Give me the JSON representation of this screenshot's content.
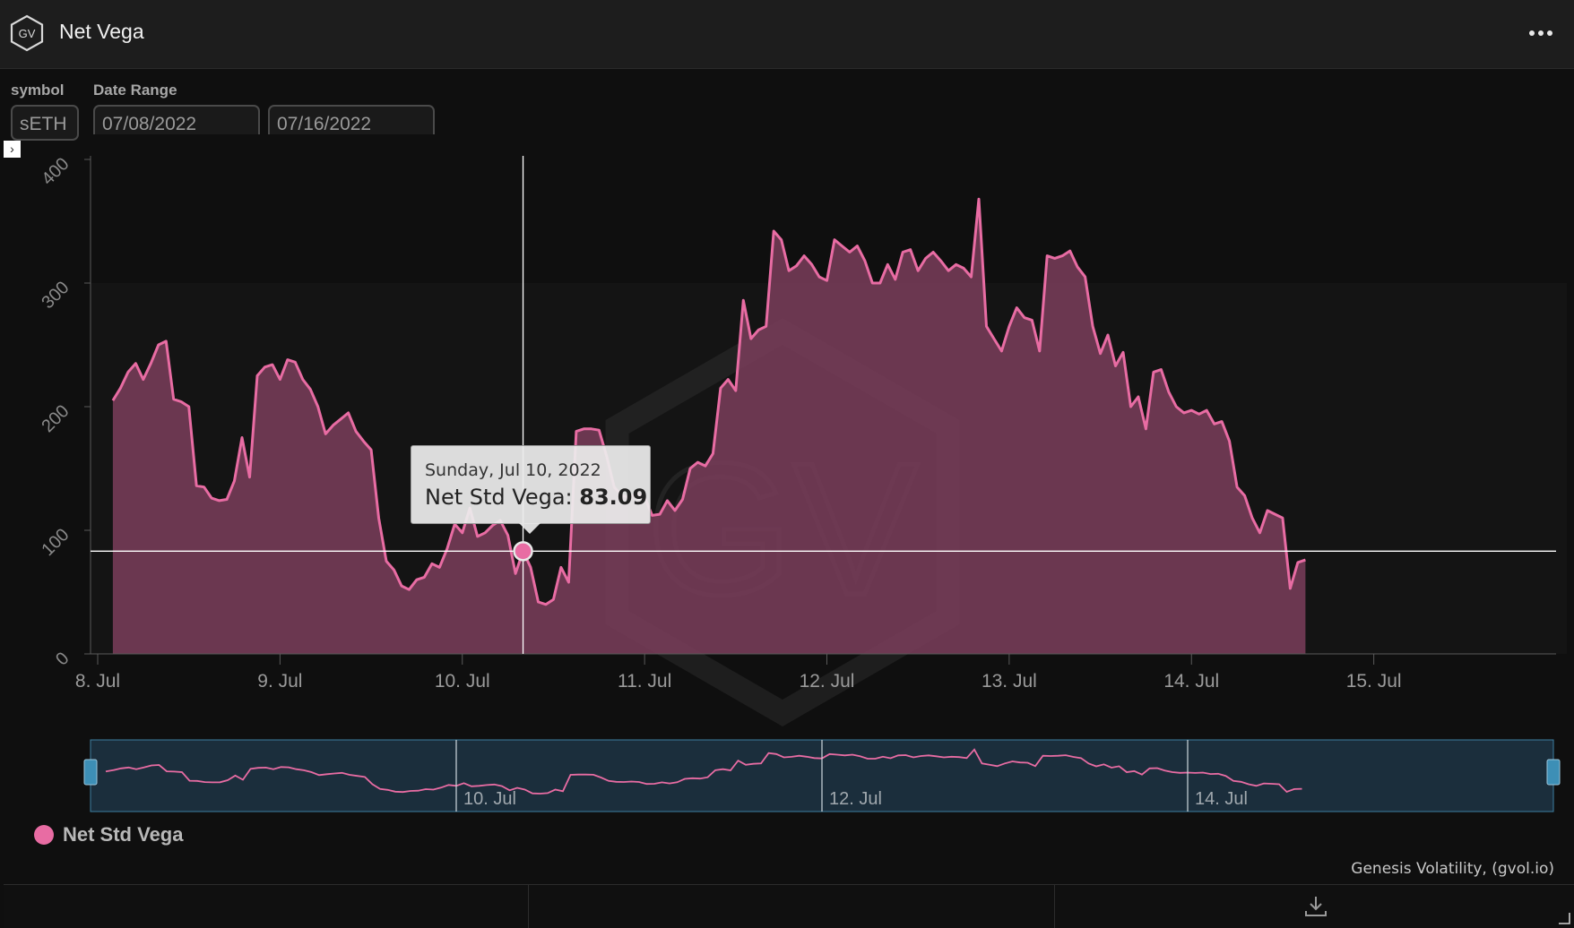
{
  "window": {
    "logo_text": "GV",
    "title": "Net Vega",
    "menu_icon": "more-horizontal-icon"
  },
  "filters": {
    "symbol_label": "symbol",
    "symbol_value": "sETH",
    "date_range_label": "Date Range",
    "date_from": "07/08/2022",
    "date_to": "07/16/2022"
  },
  "tooltip": {
    "date": "Sunday, Jul 10, 2022",
    "series_label": "Net Std Vega:",
    "value": "83.09"
  },
  "watermark_text": "GV",
  "credits": "Genesis Volatility, (gvol.io)",
  "footer": {
    "download_icon": "download-icon"
  },
  "colors": {
    "series": "#e86ca3",
    "area_fill": "#7a3d5b",
    "navigator_fill": "#1b2e3c",
    "navigator_border": "#3e7fa0"
  },
  "chart_data": {
    "type": "area",
    "title": "",
    "xlabel": "",
    "ylabel": "",
    "ylim": [
      0,
      400
    ],
    "yticks": [
      0,
      100,
      200,
      300,
      400
    ],
    "xlim": [
      "2022-07-08",
      "2022-07-16"
    ],
    "xticks": [
      "8. Jul",
      "9. Jul",
      "10. Jul",
      "11. Jul",
      "12. Jul",
      "13. Jul",
      "14. Jul",
      "15. Jul"
    ],
    "navigator_ticks": [
      "10. Jul",
      "12. Jul",
      "14. Jul"
    ],
    "grid": false,
    "legend": "bottom-left",
    "crosshair": {
      "x": "2022-07-10 08:00",
      "y": 83.09
    },
    "series": [
      {
        "name": "Net Std Vega",
        "points": [
          [
            "2022-07-08 02:00",
            205
          ],
          [
            "2022-07-08 03:00",
            215
          ],
          [
            "2022-07-08 04:00",
            228
          ],
          [
            "2022-07-08 05:00",
            235
          ],
          [
            "2022-07-08 06:00",
            222
          ],
          [
            "2022-07-08 07:00",
            235
          ],
          [
            "2022-07-08 08:00",
            250
          ],
          [
            "2022-07-08 09:00",
            253
          ],
          [
            "2022-07-08 10:00",
            206
          ],
          [
            "2022-07-08 11:00",
            204
          ],
          [
            "2022-07-08 12:00",
            200
          ],
          [
            "2022-07-08 13:00",
            136
          ],
          [
            "2022-07-08 14:00",
            135
          ],
          [
            "2022-07-08 15:00",
            126
          ],
          [
            "2022-07-08 16:00",
            124
          ],
          [
            "2022-07-08 17:00",
            125
          ],
          [
            "2022-07-08 18:00",
            140
          ],
          [
            "2022-07-08 19:00",
            175
          ],
          [
            "2022-07-08 20:00",
            143
          ],
          [
            "2022-07-08 21:00",
            225
          ],
          [
            "2022-07-08 22:00",
            232
          ],
          [
            "2022-07-08 23:00",
            234
          ],
          [
            "2022-07-09 00:00",
            222
          ],
          [
            "2022-07-09 01:00",
            238
          ],
          [
            "2022-07-09 02:00",
            236
          ],
          [
            "2022-07-09 03:00",
            222
          ],
          [
            "2022-07-09 04:00",
            214
          ],
          [
            "2022-07-09 05:00",
            200
          ],
          [
            "2022-07-09 06:00",
            178
          ],
          [
            "2022-07-09 07:00",
            185
          ],
          [
            "2022-07-09 08:00",
            190
          ],
          [
            "2022-07-09 09:00",
            195
          ],
          [
            "2022-07-09 10:00",
            180
          ],
          [
            "2022-07-09 11:00",
            172
          ],
          [
            "2022-07-09 12:00",
            165
          ],
          [
            "2022-07-09 13:00",
            110
          ],
          [
            "2022-07-09 14:00",
            75
          ],
          [
            "2022-07-09 15:00",
            68
          ],
          [
            "2022-07-09 16:00",
            55
          ],
          [
            "2022-07-09 17:00",
            52
          ],
          [
            "2022-07-09 18:00",
            60
          ],
          [
            "2022-07-09 19:00",
            62
          ],
          [
            "2022-07-09 20:00",
            73
          ],
          [
            "2022-07-09 21:00",
            70
          ],
          [
            "2022-07-09 22:00",
            85
          ],
          [
            "2022-07-09 23:00",
            105
          ],
          [
            "2022-07-10 00:00",
            98
          ],
          [
            "2022-07-10 01:00",
            118
          ],
          [
            "2022-07-10 02:00",
            95
          ],
          [
            "2022-07-10 03:00",
            98
          ],
          [
            "2022-07-10 04:00",
            104
          ],
          [
            "2022-07-10 05:00",
            108
          ],
          [
            "2022-07-10 06:00",
            96
          ],
          [
            "2022-07-10 07:00",
            65
          ],
          [
            "2022-07-10 08:00",
            83.09
          ],
          [
            "2022-07-10 09:00",
            70
          ],
          [
            "2022-07-10 10:00",
            42
          ],
          [
            "2022-07-10 11:00",
            40
          ],
          [
            "2022-07-10 12:00",
            44
          ],
          [
            "2022-07-10 13:00",
            70
          ],
          [
            "2022-07-10 14:00",
            58
          ],
          [
            "2022-07-10 15:00",
            180
          ],
          [
            "2022-07-10 16:00",
            182
          ],
          [
            "2022-07-10 17:00",
            182
          ],
          [
            "2022-07-10 18:00",
            181
          ],
          [
            "2022-07-10 19:00",
            160
          ],
          [
            "2022-07-10 20:00",
            135
          ],
          [
            "2022-07-10 21:00",
            128
          ],
          [
            "2022-07-10 22:00",
            127
          ],
          [
            "2022-07-10 23:00",
            130
          ],
          [
            "2022-07-11 00:00",
            127
          ],
          [
            "2022-07-11 01:00",
            112
          ],
          [
            "2022-07-11 02:00",
            113
          ],
          [
            "2022-07-11 03:00",
            124
          ],
          [
            "2022-07-11 04:00",
            116
          ],
          [
            "2022-07-11 05:00",
            125
          ],
          [
            "2022-07-11 06:00",
            150
          ],
          [
            "2022-07-11 07:00",
            155
          ],
          [
            "2022-07-11 08:00",
            152
          ],
          [
            "2022-07-11 09:00",
            162
          ],
          [
            "2022-07-11 10:00",
            215
          ],
          [
            "2022-07-11 11:00",
            222
          ],
          [
            "2022-07-11 12:00",
            213
          ],
          [
            "2022-07-11 13:00",
            286
          ],
          [
            "2022-07-11 14:00",
            255
          ],
          [
            "2022-07-11 15:00",
            262
          ],
          [
            "2022-07-11 16:00",
            265
          ],
          [
            "2022-07-11 17:00",
            342
          ],
          [
            "2022-07-11 18:00",
            335
          ],
          [
            "2022-07-11 19:00",
            310
          ],
          [
            "2022-07-11 20:00",
            314
          ],
          [
            "2022-07-11 21:00",
            322
          ],
          [
            "2022-07-11 22:00",
            315
          ],
          [
            "2022-07-11 23:00",
            305
          ],
          [
            "2022-07-12 00:00",
            302
          ],
          [
            "2022-07-12 01:00",
            335
          ],
          [
            "2022-07-12 02:00",
            330
          ],
          [
            "2022-07-12 03:00",
            325
          ],
          [
            "2022-07-12 04:00",
            330
          ],
          [
            "2022-07-12 05:00",
            318
          ],
          [
            "2022-07-12 06:00",
            300
          ],
          [
            "2022-07-12 07:00",
            300
          ],
          [
            "2022-07-12 08:00",
            315
          ],
          [
            "2022-07-12 09:00",
            303
          ],
          [
            "2022-07-12 10:00",
            325
          ],
          [
            "2022-07-12 11:00",
            327
          ],
          [
            "2022-07-12 12:00",
            310
          ],
          [
            "2022-07-12 13:00",
            320
          ],
          [
            "2022-07-12 14:00",
            325
          ],
          [
            "2022-07-12 15:00",
            318
          ],
          [
            "2022-07-12 16:00",
            310
          ],
          [
            "2022-07-12 17:00",
            315
          ],
          [
            "2022-07-12 18:00",
            312
          ],
          [
            "2022-07-12 19:00",
            305
          ],
          [
            "2022-07-12 20:00",
            368
          ],
          [
            "2022-07-12 21:00",
            265
          ],
          [
            "2022-07-12 22:00",
            255
          ],
          [
            "2022-07-12 23:00",
            245
          ],
          [
            "2022-07-13 00:00",
            265
          ],
          [
            "2022-07-13 01:00",
            280
          ],
          [
            "2022-07-13 02:00",
            272
          ],
          [
            "2022-07-13 03:00",
            270
          ],
          [
            "2022-07-13 04:00",
            245
          ],
          [
            "2022-07-13 05:00",
            322
          ],
          [
            "2022-07-13 06:00",
            320
          ],
          [
            "2022-07-13 07:00",
            322
          ],
          [
            "2022-07-13 08:00",
            326
          ],
          [
            "2022-07-13 09:00",
            313
          ],
          [
            "2022-07-13 10:00",
            305
          ],
          [
            "2022-07-13 11:00",
            265
          ],
          [
            "2022-07-13 12:00",
            243
          ],
          [
            "2022-07-13 13:00",
            258
          ],
          [
            "2022-07-13 14:00",
            233
          ],
          [
            "2022-07-13 15:00",
            244
          ],
          [
            "2022-07-13 16:00",
            200
          ],
          [
            "2022-07-13 17:00",
            208
          ],
          [
            "2022-07-13 18:00",
            182
          ],
          [
            "2022-07-13 19:00",
            228
          ],
          [
            "2022-07-13 20:00",
            230
          ],
          [
            "2022-07-13 21:00",
            212
          ],
          [
            "2022-07-13 22:00",
            200
          ],
          [
            "2022-07-13 23:00",
            195
          ],
          [
            "2022-07-14 00:00",
            197
          ],
          [
            "2022-07-14 01:00",
            194
          ],
          [
            "2022-07-14 02:00",
            197
          ],
          [
            "2022-07-14 03:00",
            186
          ],
          [
            "2022-07-14 04:00",
            188
          ],
          [
            "2022-07-14 05:00",
            172
          ],
          [
            "2022-07-14 06:00",
            135
          ],
          [
            "2022-07-14 07:00",
            128
          ],
          [
            "2022-07-14 08:00",
            110
          ],
          [
            "2022-07-14 09:00",
            98
          ],
          [
            "2022-07-14 10:00",
            116
          ],
          [
            "2022-07-14 11:00",
            113
          ],
          [
            "2022-07-14 12:00",
            110
          ],
          [
            "2022-07-14 13:00",
            53
          ],
          [
            "2022-07-14 14:00",
            74
          ],
          [
            "2022-07-14 15:00",
            76
          ]
        ]
      }
    ]
  }
}
